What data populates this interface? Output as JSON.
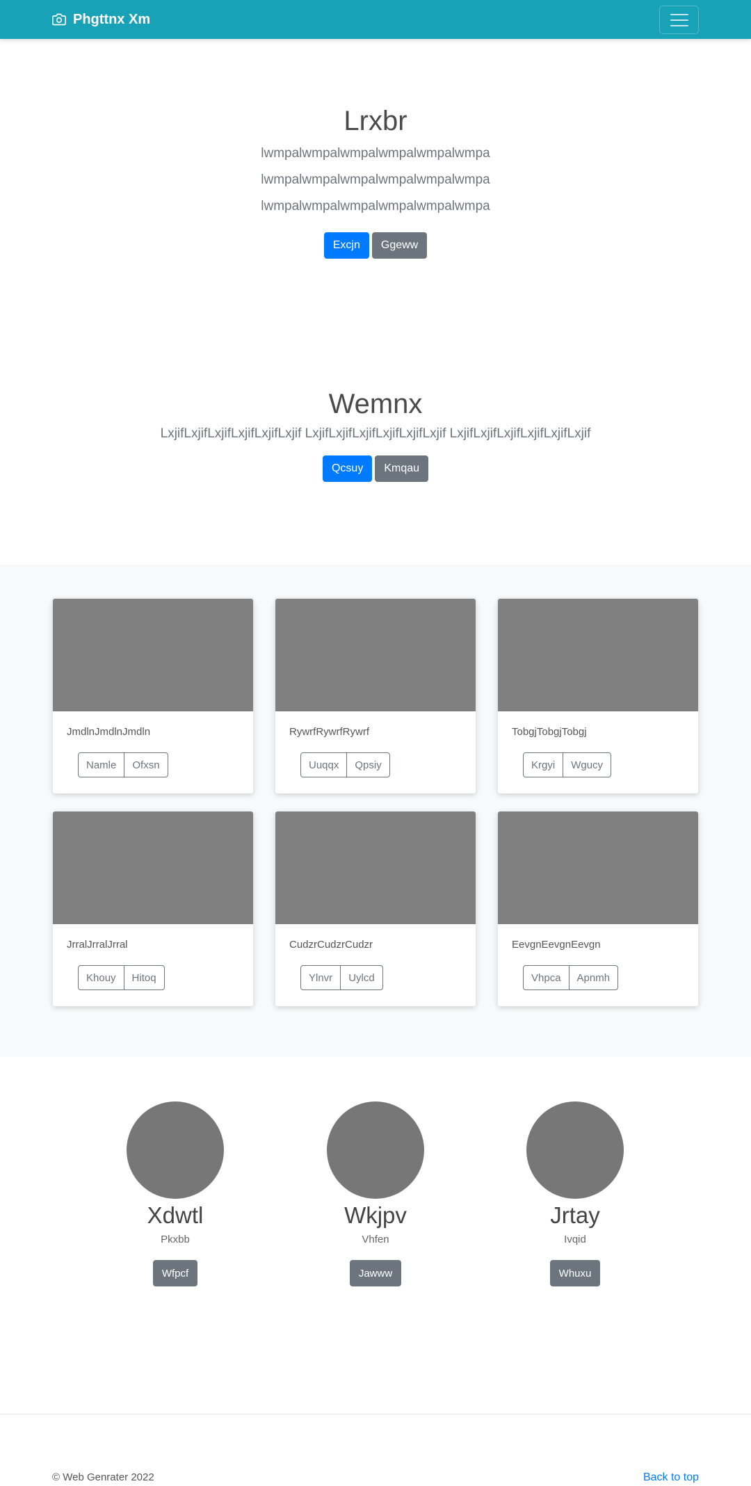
{
  "navbar": {
    "brand": "Phgttnx Xm",
    "brand_icon": "camera-icon",
    "menu_icon": "hamburger-menu-icon",
    "color": "#17a2b8"
  },
  "hero1": {
    "title": "Lrxbr",
    "lines": [
      "lwmpalwmpalwmpalwmpalwmpalwmpa",
      "lwmpalwmpalwmpalwmpalwmpalwmpa",
      "lwmpalwmpalwmpalwmpalwmpalwmpa"
    ],
    "primary_button": "Excjn",
    "secondary_button": "Ggeww"
  },
  "hero2": {
    "title": "Wemnx",
    "text": "LxjifLxjifLxjifLxjifLxjifLxjif LxjifLxjifLxjifLxjifLxjifLxjif LxjifLxjifLxjifLxjifLxjifLxjif",
    "primary_button": "Qcsuy",
    "secondary_button": "Kmqau"
  },
  "cards": [
    {
      "text": "JmdlnJmdlnJmdln",
      "buttons": [
        "Namle",
        "Ofxsn"
      ]
    },
    {
      "text": "RywrfRywrfRywrf",
      "buttons": [
        "Uuqqx",
        "Qpsiy"
      ]
    },
    {
      "text": "TobgjTobgjTobgj",
      "buttons": [
        "Krgyi",
        "Wgucy"
      ]
    },
    {
      "text": "JrralJrralJrral",
      "buttons": [
        "Khouy",
        "Hitoq"
      ]
    },
    {
      "text": "CudzrCudzrCudzr",
      "buttons": [
        "Ylnvr",
        "Uylcd"
      ]
    },
    {
      "text": "EevgnEevgnEevgn",
      "buttons": [
        "Vhpca",
        "Apnmh"
      ]
    }
  ],
  "team": [
    {
      "name": "Xdwtl",
      "role": "Pkxbb",
      "button": "Wfpcf"
    },
    {
      "name": "Wkjpv",
      "role": "Vhfen",
      "button": "Jawww"
    },
    {
      "name": "Jrtay",
      "role": "Ivqid",
      "button": "Whuxu"
    }
  ],
  "footer": {
    "copyright": "© Web Genrater 2022",
    "back_to_top": "Back to top"
  }
}
